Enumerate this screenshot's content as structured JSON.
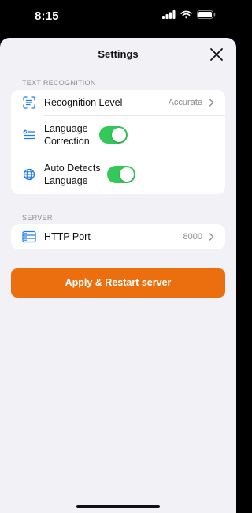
{
  "status_bar": {
    "time": "8:15",
    "icons": [
      "signal-icon",
      "wifi-icon",
      "battery-icon"
    ]
  },
  "nav": {
    "title": "Settings",
    "close_icon": "close-icon"
  },
  "sections": {
    "text_recognition": {
      "header": "TEXT RECOGNITION",
      "rows": {
        "recognition_level": {
          "label": "Recognition Level",
          "value": "Accurate",
          "icon": "text-scan-icon"
        },
        "language_correction": {
          "label": "Language Correction",
          "icon": "checklist-icon",
          "enabled": true
        },
        "auto_detects_language": {
          "label": "Auto Detects Language",
          "icon": "globe-icon",
          "enabled": true
        }
      }
    },
    "server": {
      "header": "SERVER",
      "rows": {
        "http_port": {
          "label": "HTTP Port",
          "value": "8000",
          "icon": "server-icon"
        }
      }
    }
  },
  "primary_button": {
    "label": "Apply & Restart server"
  },
  "colors": {
    "accent_blue": "#1e7bf2",
    "toggle_on": "#34c759",
    "primary_button": "#ec6f0f",
    "sheet_background": "#f2f2f6"
  }
}
